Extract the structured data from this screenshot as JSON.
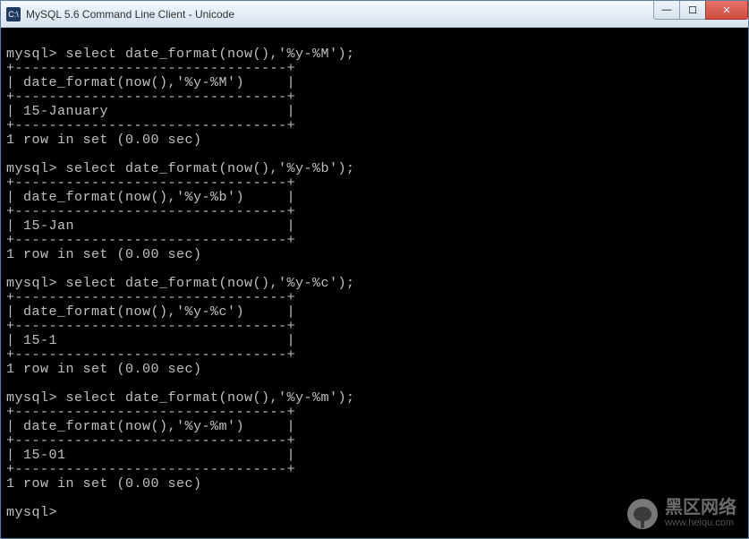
{
  "window": {
    "title": "MySQL 5.6 Command Line Client - Unicode",
    "controls": {
      "min": "—",
      "max": "☐",
      "close": "✕"
    }
  },
  "prompt": "mysql>",
  "queries": [
    {
      "fmt": "%y-%M",
      "result": "15-January"
    },
    {
      "fmt": "%y-%b",
      "result": "15-Jan"
    },
    {
      "fmt": "%y-%c",
      "result": "15-1"
    },
    {
      "fmt": "%y-%m",
      "result": "15-01"
    }
  ],
  "row_status": "1 row in set (0.00 sec)",
  "watermark": {
    "cn": "黑区网络",
    "url": "www.heiqu.com"
  }
}
